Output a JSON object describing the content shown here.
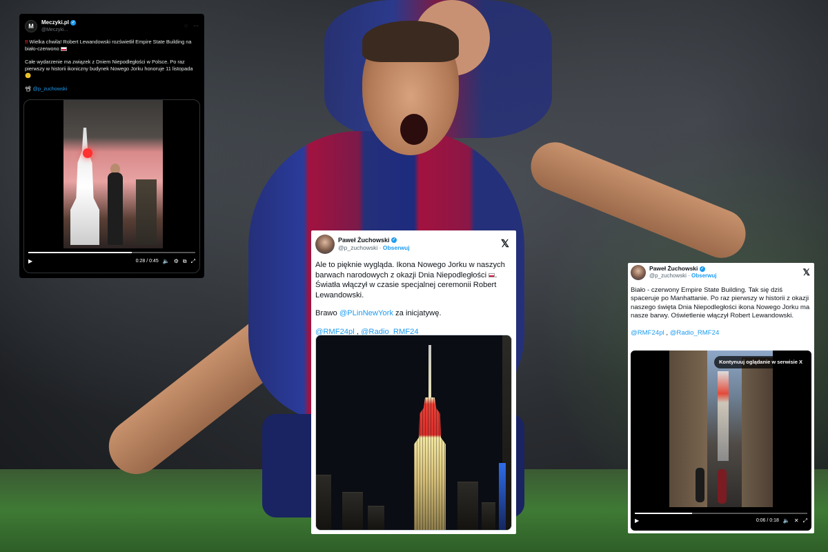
{
  "tweet_meczyki": {
    "name": "Meczyki.pl",
    "handle": "@Meczyki...",
    "avatar_letter": "M",
    "line1": "Wielka chwila! Robert Lewandowski rozświetlił Empire State Building na biało-czerwono",
    "line2": "Całe wydarzenie ma związek z Dniem Niepodległości w Polsce. Po raz pierwszy w historii ikoniczny budynek Nowego Jorku honoruje 11 listopada",
    "credit": "@p_zuchowski",
    "video_time": "0:28 / 0:45",
    "video_progress": 0.62
  },
  "tweet_center": {
    "name": "Paweł Żuchowski",
    "handle": "@p_zuchowski",
    "follow": "Obserwuj",
    "text1": "Ale to pięknie wygląda. Ikona Nowego Jorku w naszych barwach narodowych z okazji Dnia Niepodległości",
    "text1b": ". Światła włączył w czasie specjalnej ceremonii Robert Lewandowski.",
    "text2_pre": "Brawo",
    "text2_link": "@PLinNewYork",
    "text2_post": "za inicjatywę.",
    "mention1": "@RMF24pl",
    "mention_sep": ",",
    "mention2": "@Radio_RMF24"
  },
  "tweet_right": {
    "name": "Paweł Żuchowski",
    "handle": "@p_zuchowski",
    "follow": "Obserwuj",
    "text1": "Biało - czerwony Empire State Building. Tak się dziś spaceruje po Manhattanie. Po raz pierwszy w historii z okazji naszego święta Dnia Niepodległości ikona Nowego Jorku ma nasze barwy.  Oświetlenie włączył Robert Lewandowski.",
    "mention1": "@RMF24pl",
    "mention_sep": ",",
    "mention2": "@Radio_RMF24",
    "continue_label": "Kontynuuj oglądanie w serwisie X",
    "video_time": "0:06 / 0:18",
    "video_progress": 0.33
  },
  "colors": {
    "x_blue": "#1d9bf0",
    "dark_card": "#000000",
    "light_card": "#ffffff",
    "barca_blue": "#25307a",
    "barca_red": "#a3123f"
  },
  "icons": [
    "verified-icon",
    "more-icon",
    "x-logo-icon",
    "play-icon",
    "volume-icon",
    "settings-icon",
    "fullscreen-icon",
    "pip-icon"
  ]
}
